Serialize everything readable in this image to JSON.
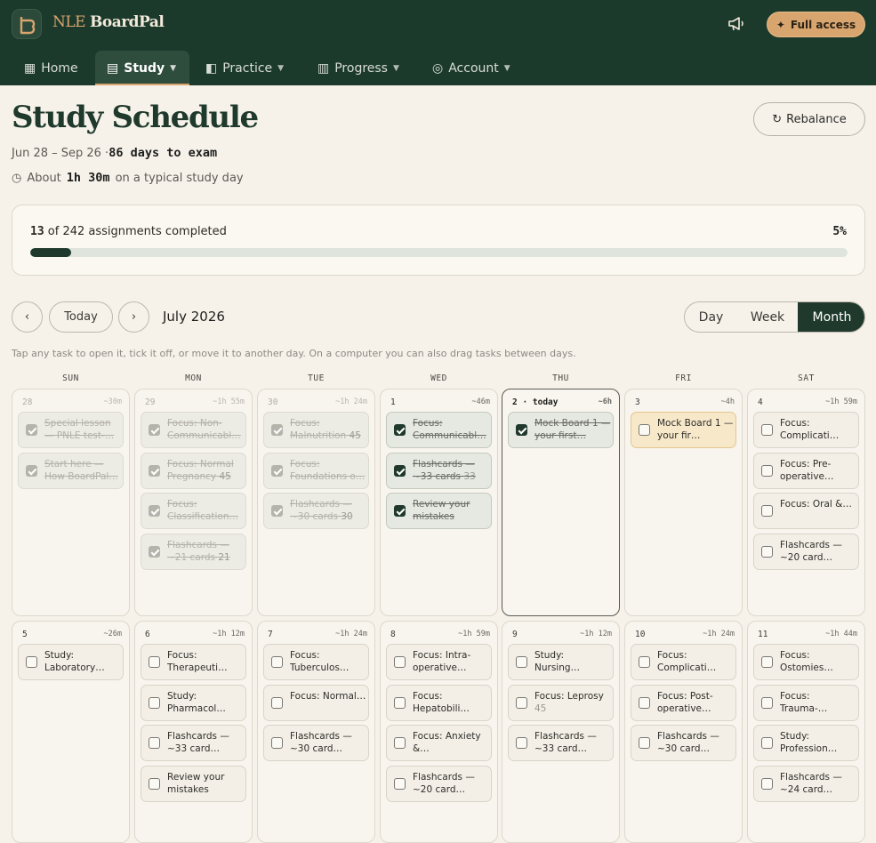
{
  "app": {
    "brand_a": "NLE",
    "brand_b": "BoardPal",
    "full_access_label": "Full access"
  },
  "nav": {
    "home": "Home",
    "study": "Study",
    "practice": "Practice",
    "progress": "Progress",
    "account": "Account"
  },
  "header": {
    "title": "Study Schedule",
    "date_range": "Jun 28 – Sep 26 ·",
    "days_to_exam": "86 days to exam",
    "typical_prefix": "About",
    "typical_time": "1h 30m",
    "typical_suffix": "on a typical study day",
    "rebalance_label": "Rebalance"
  },
  "progress": {
    "completed": "13",
    "total_text": "of 242 assignments completed",
    "percent_label": "5%",
    "fraction": 0.05
  },
  "calendar_controls": {
    "today_label": "Today",
    "month_label": "July 2026",
    "views": [
      "Day",
      "Week",
      "Month"
    ],
    "active_view": "Month",
    "hint": "Tap any task to open it, tick it off, or move it to another day. On a computer you can also drag tasks between days."
  },
  "weekdays": [
    "SUN",
    "MON",
    "TUE",
    "WED",
    "THU",
    "FRI",
    "SAT"
  ],
  "weeks": [
    [
      {
        "day": "28",
        "est": "~30m",
        "past": true,
        "tasks": [
          {
            "text": "Special lesson — PNLE test-…",
            "done": true
          },
          {
            "text": "Start here — How BoardPal…",
            "done": true
          }
        ]
      },
      {
        "day": "29",
        "est": "~1h 55m",
        "past": true,
        "tasks": [
          {
            "text": "Focus: Non-Communicabl…",
            "done": true
          },
          {
            "text": "Focus: Normal Pregnancy",
            "extra": "45",
            "done": true
          },
          {
            "text": "Focus: Classification…",
            "done": true
          },
          {
            "text": "Flashcards — ~21 cards",
            "extra": "21",
            "done": true
          }
        ]
      },
      {
        "day": "30",
        "est": "~1h 24m",
        "past": true,
        "tasks": [
          {
            "text": "Focus: Malnutrition",
            "extra": "45",
            "done": true
          },
          {
            "text": "Focus: Foundations o…",
            "done": true
          },
          {
            "text": "Flashcards — ~30 cards",
            "extra": "30",
            "done": true
          }
        ]
      },
      {
        "day": "1",
        "est": "~46m",
        "tasks": [
          {
            "text": "Focus: Communicabl…",
            "done": true
          },
          {
            "text": "Flashcards — ~33 cards",
            "extra": "33",
            "done": true
          },
          {
            "text": "Review your mistakes",
            "done": true
          }
        ]
      },
      {
        "day": "2 · today",
        "est": "~6h",
        "today": true,
        "tasks": [
          {
            "text": "Mock Board 1 — your first…",
            "done": true
          }
        ]
      },
      {
        "day": "3",
        "est": "~4h",
        "tasks": [
          {
            "text": "Mock Board 1 — your fir…",
            "exam": true
          }
        ]
      },
      {
        "day": "4",
        "est": "~1h 59m",
        "tasks": [
          {
            "text": "Focus: Complicati…"
          },
          {
            "text": "Focus: Pre-operative…"
          },
          {
            "text": "Focus: Oral &…"
          },
          {
            "text": "Flashcards — ~20 card…"
          }
        ]
      }
    ],
    [
      {
        "day": "5",
        "est": "~26m",
        "tasks": [
          {
            "text": "Study: Laboratory…"
          }
        ]
      },
      {
        "day": "6",
        "est": "~1h 12m",
        "tasks": [
          {
            "text": "Focus: Therapeuti…"
          },
          {
            "text": "Study: Pharmacol…"
          },
          {
            "text": "Flashcards — ~33 card…"
          },
          {
            "text": "Review your mistakes"
          }
        ]
      },
      {
        "day": "7",
        "est": "~1h 24m",
        "tasks": [
          {
            "text": "Focus: Tuberculos…"
          },
          {
            "text": "Focus: Normal…"
          },
          {
            "text": "Flashcards — ~30 card…"
          }
        ]
      },
      {
        "day": "8",
        "est": "~1h 59m",
        "tasks": [
          {
            "text": "Focus: Intra-operative…"
          },
          {
            "text": "Focus: Hepatobili…"
          },
          {
            "text": "Focus: Anxiety &…"
          },
          {
            "text": "Flashcards — ~20 card…"
          }
        ]
      },
      {
        "day": "9",
        "est": "~1h 12m",
        "tasks": [
          {
            "text": "Study: Nursing…"
          },
          {
            "text": "Focus: Leprosy",
            "extra": "45"
          },
          {
            "text": "Flashcards — ~33 card…"
          }
        ]
      },
      {
        "day": "10",
        "est": "~1h 24m",
        "tasks": [
          {
            "text": "Focus: Complicati…"
          },
          {
            "text": "Focus: Post-operative…"
          },
          {
            "text": "Flashcards — ~30 card…"
          }
        ]
      },
      {
        "day": "11",
        "est": "~1h 44m",
        "tasks": [
          {
            "text": "Focus: Ostomies…"
          },
          {
            "text": "Focus: Trauma-…"
          },
          {
            "text": "Study: Profession…"
          },
          {
            "text": "Flashcards — ~24 card…"
          }
        ]
      }
    ]
  ]
}
